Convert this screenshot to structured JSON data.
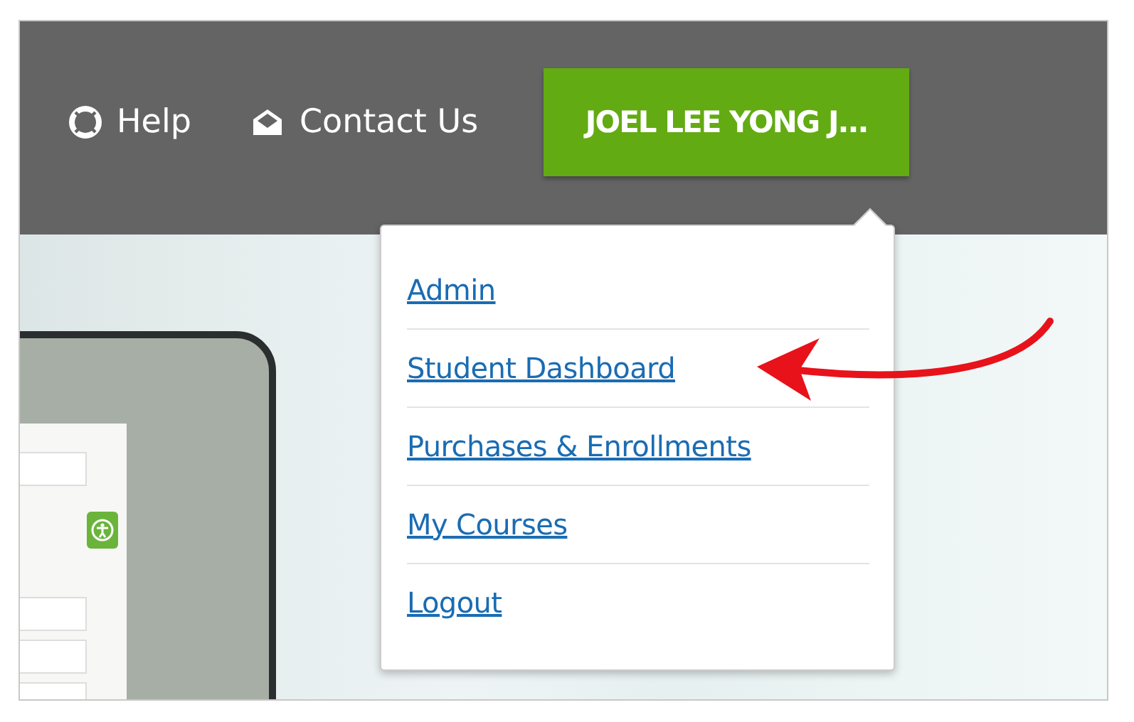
{
  "nav": {
    "links": [
      {
        "label": "Help",
        "kind": "help"
      },
      {
        "label": "Contact Us",
        "kind": "contact"
      }
    ],
    "user_button": {
      "label": "JOEL LEE YONG J..."
    }
  },
  "user_menu": {
    "expanded": true,
    "items": [
      {
        "label": "Admin"
      },
      {
        "label": "Student Dashboard"
      },
      {
        "label": "Purchases & Enrollments"
      },
      {
        "label": "My Courses"
      },
      {
        "label": "Logout"
      }
    ]
  }
}
